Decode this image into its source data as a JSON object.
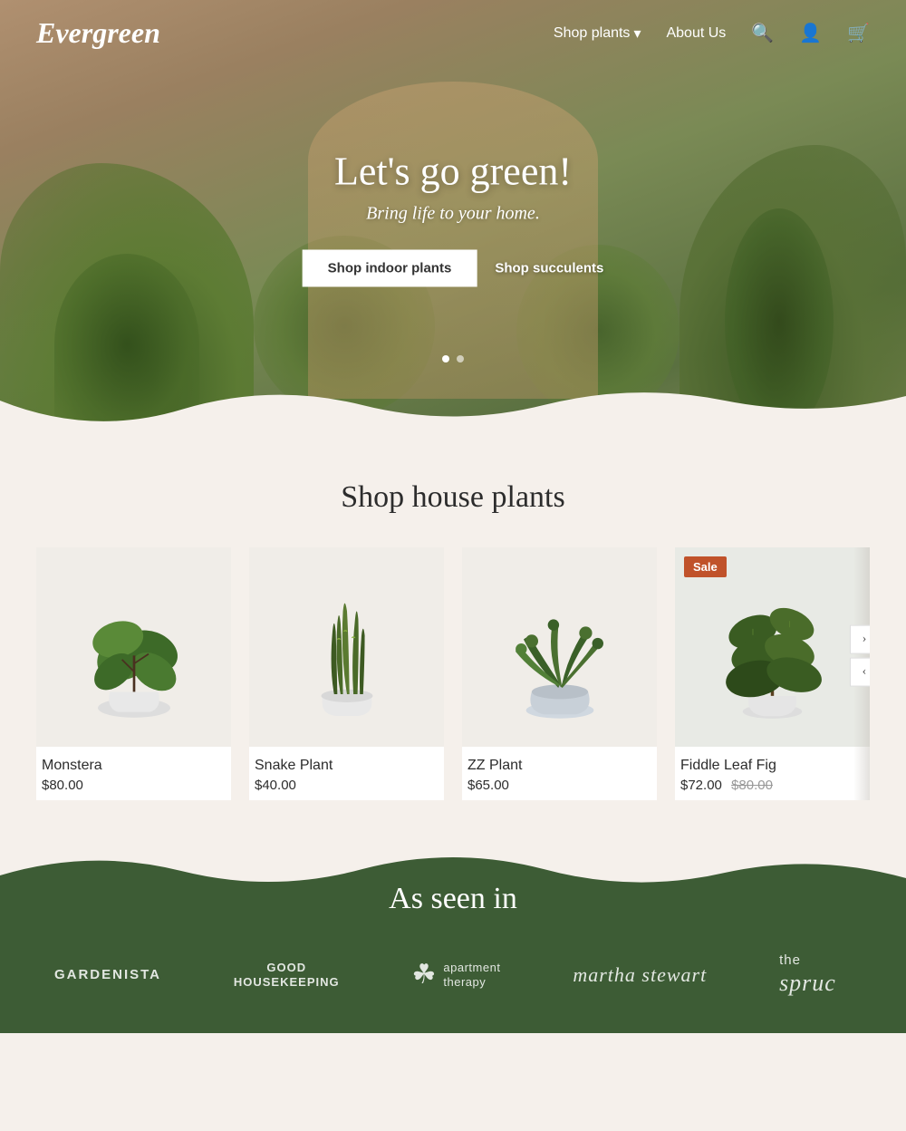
{
  "header": {
    "logo": "Evergreen",
    "nav": {
      "shop_plants": "Shop plants",
      "about_us": "About Us"
    }
  },
  "hero": {
    "title": "Let's go green!",
    "subtitle": "Bring life to your home.",
    "btn_primary": "Shop indoor plants",
    "btn_secondary": "Shop succulents"
  },
  "shop": {
    "title": "Shop house plants",
    "products": [
      {
        "name": "Monstera",
        "price": "$80.00",
        "original_price": null,
        "sale": false
      },
      {
        "name": "Snake Plant",
        "price": "$40.00",
        "original_price": null,
        "sale": false
      },
      {
        "name": "ZZ Plant",
        "price": "$65.00",
        "original_price": null,
        "sale": false
      },
      {
        "name": "Fiddle Leaf Fig",
        "price": "$72.00",
        "original_price": "$80.00",
        "sale": true
      }
    ]
  },
  "as_seen_in": {
    "title": "As seen in",
    "brands": [
      {
        "name": "GARDENISTA",
        "type": "text"
      },
      {
        "name": "GOOD\nHOUSEKEEPING",
        "type": "stacked"
      },
      {
        "name": "apartment therapy",
        "type": "icon-text"
      },
      {
        "name": "martha stewart",
        "type": "script"
      },
      {
        "name": "the spruc",
        "type": "script-partial"
      }
    ]
  },
  "icons": {
    "search": "🔍",
    "account": "👤",
    "cart": "🛒",
    "chevron_down": "▾",
    "arrow_right": "›",
    "arrow_left": "‹"
  }
}
